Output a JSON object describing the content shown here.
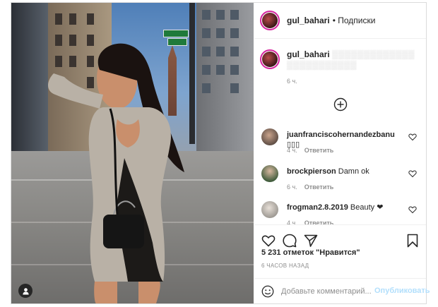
{
  "post": {
    "author": "gul_bahari",
    "follow_label": "• Подписки",
    "caption_user": "gul_bahari",
    "caption_time": "6 ч."
  },
  "comments": [
    {
      "user": "juanfranciscohernandezbanu",
      "text": "▯▯▯",
      "time": "4 ч.",
      "reply": "Ответить"
    },
    {
      "user": "brockpierson",
      "text": "Damn ok",
      "time": "6 ч.",
      "reply": "Ответить"
    },
    {
      "user": "frogman2.8.2019",
      "text": "Beauty ❤",
      "time": "4 ч.",
      "reply": "Ответить"
    }
  ],
  "likes_label": "5 231 отметок \"Нравится\"",
  "posted_ago": "6 ЧАСОВ НАЗАД",
  "add_comment": {
    "placeholder": "Добавьте комментарий...",
    "publish_label": "Опубликовать"
  },
  "icons": {
    "like": "heart-icon",
    "comment": "comment-icon",
    "share": "share-icon",
    "save": "bookmark-icon",
    "more": "plus-circle-icon",
    "emoji": "smile-icon",
    "user_tag": "user-icon"
  },
  "colors": {
    "story_ring": "#d6249f",
    "text": "#262626",
    "muted": "#8e8e8e",
    "publish_disabled": "#b2dffc",
    "border": "#dbdbdb"
  }
}
